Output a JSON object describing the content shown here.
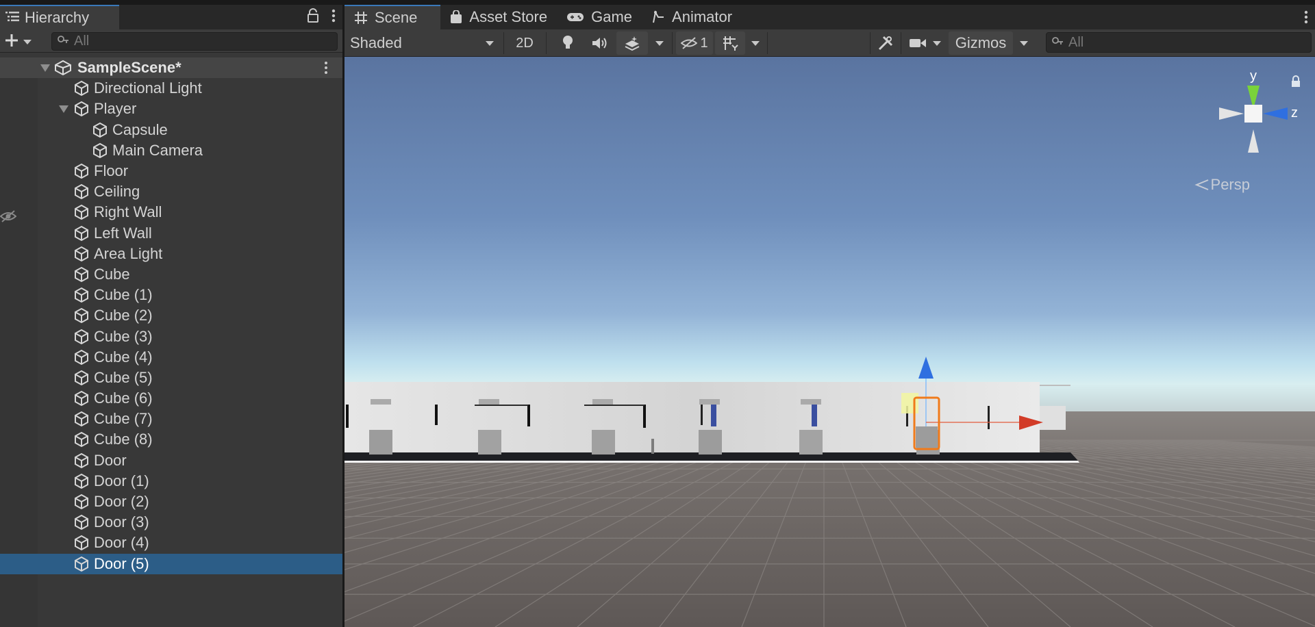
{
  "hierarchy": {
    "tab_label": "Hierarchy",
    "search_placeholder": "All",
    "scene_name": "SampleScene*",
    "items": [
      {
        "label": "Directional Light"
      },
      {
        "label": "Player"
      },
      {
        "label": "Capsule"
      },
      {
        "label": "Main Camera"
      },
      {
        "label": "Floor"
      },
      {
        "label": "Ceiling"
      },
      {
        "label": "Right Wall"
      },
      {
        "label": "Left Wall"
      },
      {
        "label": "Area Light"
      },
      {
        "label": "Cube"
      },
      {
        "label": "Cube (1)"
      },
      {
        "label": "Cube (2)"
      },
      {
        "label": "Cube (3)"
      },
      {
        "label": "Cube (4)"
      },
      {
        "label": "Cube (5)"
      },
      {
        "label": "Cube (6)"
      },
      {
        "label": "Cube (7)"
      },
      {
        "label": "Cube (8)"
      },
      {
        "label": "Door"
      },
      {
        "label": "Door (1)"
      },
      {
        "label": "Door (2)"
      },
      {
        "label": "Door (3)"
      },
      {
        "label": "Door (4)"
      },
      {
        "label": "Door (5)"
      }
    ]
  },
  "scene_tabs": [
    {
      "label": "Scene",
      "icon": "grid-icon"
    },
    {
      "label": "Asset Store",
      "icon": "bag-icon"
    },
    {
      "label": "Game",
      "icon": "gamepad-icon"
    },
    {
      "label": "Animator",
      "icon": "animator-icon"
    }
  ],
  "scene_toolbar": {
    "draw_mode": "Shaded",
    "mode_2d": "2D",
    "hidden_count": "1",
    "gizmos": "Gizmos",
    "search_placeholder": "All"
  },
  "viewport": {
    "projection": "Persp",
    "axis_y": "y",
    "axis_z": "z"
  },
  "colors": {
    "selection": "#2c5d87",
    "tab_accent": "#3a79bb",
    "axis_x": "#d23c28",
    "axis_y": "#7ad33a",
    "axis_z": "#2f6fe0"
  }
}
